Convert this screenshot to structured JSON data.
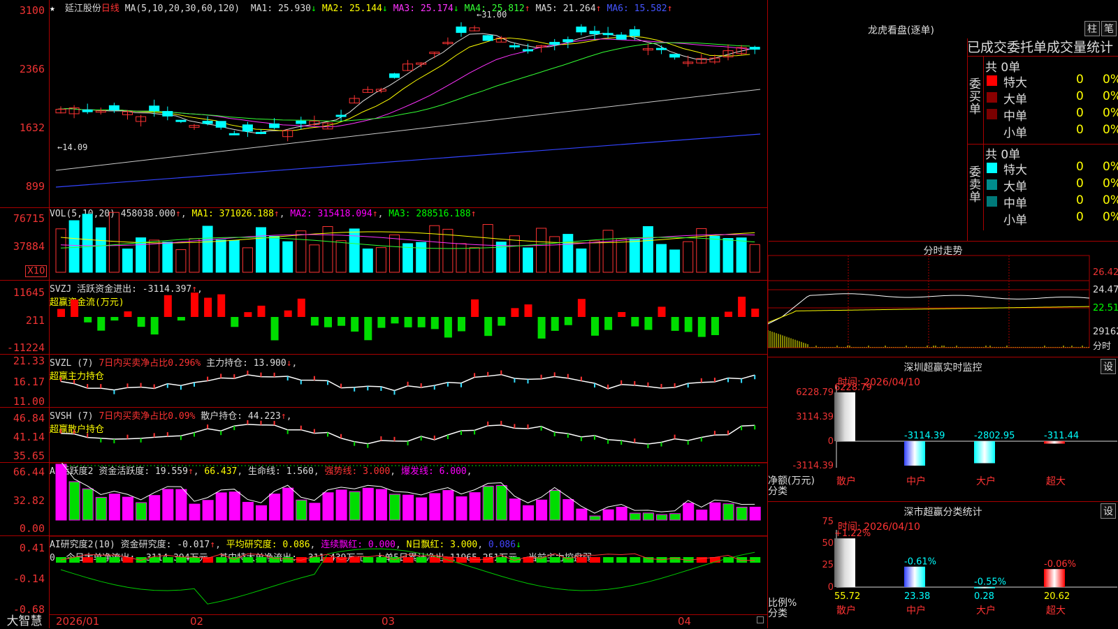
{
  "app": {
    "brand": "大智慧"
  },
  "main": {
    "stock_name": "延江股份",
    "period": "日线",
    "ma_header": "MA(5,10,20,30,60,120)",
    "ma": [
      {
        "label": "MA1:",
        "value": "25.930",
        "arrow": "↓",
        "color": "#dddddd"
      },
      {
        "label": "MA2:",
        "value": "25.144",
        "arrow": "↓",
        "color": "#ffff00"
      },
      {
        "label": "MA3:",
        "value": "25.174",
        "arrow": "↓",
        "color": "#ff33ff"
      },
      {
        "label": "MA4:",
        "value": "25.812",
        "arrow": "↑",
        "color": "#33ff33"
      },
      {
        "label": "MA5:",
        "value": "21.264",
        "arrow": "↑",
        "color": "#dddddd"
      },
      {
        "label": "MA6:",
        "value": "15.582",
        "arrow": "↑",
        "color": "#4455ff"
      }
    ],
    "y_labels": [
      "3100",
      "2366",
      "1632",
      "899"
    ],
    "high_label": "31.00",
    "low_label": "14.09"
  },
  "vol": {
    "header": "VOL(5,10,20)",
    "value": "458038.000",
    "ma1": "MA1: 371026.188",
    "ma2": "MA2: 315418.094",
    "ma3": "MA3: 288516.188",
    "y_labels": [
      "76715",
      "37884"
    ],
    "unit": "X10"
  },
  "svzj": {
    "header": "SVZJ",
    "label": "活跃资金进出: -3114.397",
    "title": "超赢资金流(万元)",
    "y_labels": [
      "11645",
      "211",
      "-11224"
    ]
  },
  "svzl": {
    "header": "SVZL (7)",
    "ratio": "7日内买卖净占比0.296%",
    "hold": "主力持仓: 13.900",
    "title": "超赢主力持仓",
    "y_labels": [
      "21.33",
      "16.17",
      "11.00"
    ]
  },
  "svsh": {
    "header": "SVSH (7)",
    "ratio": "7日内买卖净占比0.09%",
    "hold": "散户持仓: 44.223",
    "title": "超赢散户持仓",
    "y_labels": [
      "46.84",
      "41.14",
      "35.65"
    ]
  },
  "ai_active": {
    "header": "AI活跃度2",
    "active": "资金活跃度: 19.559",
    "v2": "66.437",
    "life": "生命线: 1.560",
    "strong": "强势线: 3.000",
    "burst": "爆发线: 6.000",
    "y_labels": [
      "66.44",
      "32.82",
      "0.00"
    ]
  },
  "ai_research": {
    "header": "AI研究度2(10)",
    "research": "资金研究度: -0.017",
    "avg": "平均研究度: 0.086",
    "red": "连续飘红: 0.000",
    "nred": "N日飘红: 3.000",
    "v5": "0.086",
    "desc": "0, 今日大单净流出: -3114.394万元, 其中特大单净流出: -311.439万元, 大单5日累计净出-11965.251万元, 当前主力控盘弱",
    "y_labels": [
      "0.41",
      "-0.14",
      "-0.68"
    ]
  },
  "x_axis": [
    "2026/01",
    "02",
    "03",
    "04"
  ],
  "side": {
    "title": "龙虎看盘(逐单)",
    "btn_bar": "柱",
    "btn_pen": "笔",
    "tab_header": "已成交委托单成交量统计",
    "buy_label": "委买单",
    "sell_label": "委卖单",
    "buy_total": "共 0单",
    "sell_total": "共 0单",
    "buy_rows": [
      {
        "name": "特大",
        "count": "0",
        "pct": "0%",
        "color": "#ff0000"
      },
      {
        "name": "大单",
        "count": "0",
        "pct": "0%",
        "color": "#8b0000"
      },
      {
        "name": "中单",
        "count": "0",
        "pct": "0%",
        "color": "#7a0000"
      },
      {
        "name": "小单",
        "count": "0",
        "pct": "0%",
        "color": "#000000"
      }
    ],
    "sell_rows": [
      {
        "name": "特大",
        "count": "0",
        "pct": "0%",
        "color": "#00ffff"
      },
      {
        "name": "大单",
        "count": "0",
        "pct": "0%",
        "color": "#008b8b"
      },
      {
        "name": "中单",
        "count": "0",
        "pct": "0%",
        "color": "#007a7a"
      },
      {
        "name": "小单",
        "count": "0",
        "pct": "0%",
        "color": "#000000"
      }
    ],
    "intraday": {
      "title": "分时走势",
      "y_labels": [
        "26.42",
        "24.47",
        "22.51",
        "29162"
      ],
      "x_label": "分时"
    },
    "sz_monitor": {
      "title": "深圳超赢实时监控",
      "btn": "设",
      "time": "时间: 2026/04/10",
      "y_labels": [
        "6228.79",
        "3114.39",
        "0",
        "-3114.39"
      ],
      "axis_title": "净额(万元)",
      "axis_sub": "分类",
      "bars": [
        {
          "cat": "散户",
          "value": 6228.79,
          "label": "6228.79"
        },
        {
          "cat": "中户",
          "value": -3114.39,
          "label": "-3114.39"
        },
        {
          "cat": "大户",
          "value": -2802.95,
          "label": "-2802.95"
        },
        {
          "cat": "超大",
          "value": -311.44,
          "label": "-311.44"
        }
      ]
    },
    "sz_class": {
      "title": "深市超赢分类统计",
      "btn": "设",
      "time": "时间: 2026/04/10",
      "y_labels": [
        "75",
        "50",
        "25",
        "0"
      ],
      "axis_title": "比例%",
      "axis_sub": "分类",
      "bars": [
        {
          "cat": "散户",
          "ratio": 55.72,
          "label": "55.72",
          "top": "+1.22%"
        },
        {
          "cat": "中户",
          "ratio": 23.38,
          "label": "23.38",
          "top": "-0.61%"
        },
        {
          "cat": "大户",
          "ratio": 0.28,
          "label": "0.28",
          "top": "-0.55%"
        },
        {
          "cat": "超大",
          "ratio": 20.62,
          "label": "20.62",
          "top": "-0.06%"
        }
      ]
    }
  }
}
